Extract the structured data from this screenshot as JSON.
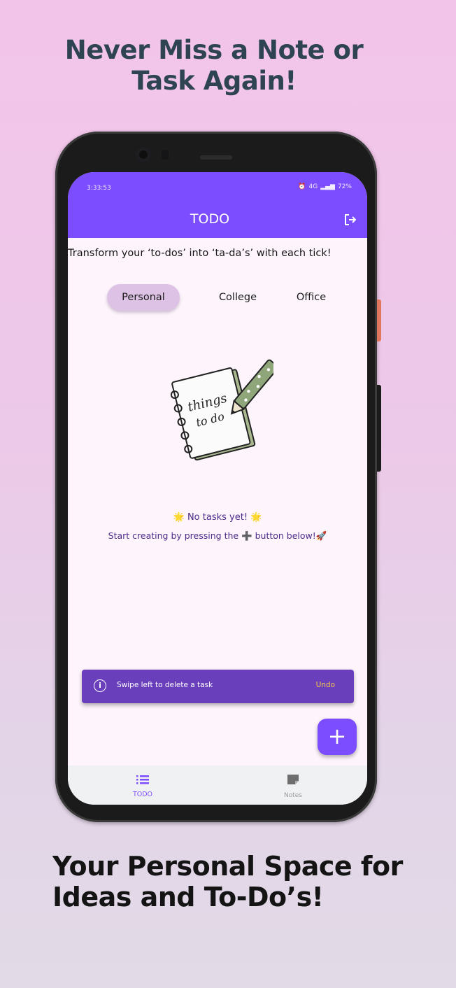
{
  "promo": {
    "headline_line1": "Never Miss a Note or",
    "headline_line2": "Task Again!",
    "footer_line1": "Your Personal Space for",
    "footer_line2": "Ideas and To-Do’s!"
  },
  "status_bar": {
    "time": "3:33:53",
    "battery": "72%",
    "network": "4G"
  },
  "app_bar": {
    "title": "TODO",
    "logout_icon": "logout-icon"
  },
  "tagline": "Transform your ‘to-dos’ into ‘ta-da’s’ with each tick!",
  "tabs": [
    {
      "label": "Personal",
      "selected": true
    },
    {
      "label": "College",
      "selected": false
    },
    {
      "label": "Office",
      "selected": false
    }
  ],
  "illustration": {
    "text_line1": "things",
    "text_line2": "to do"
  },
  "empty_state": {
    "line1": "🌟 No tasks yet! 🌟",
    "line2": "Start creating by pressing the ➕ button below!🚀"
  },
  "snackbar": {
    "icon": "info-icon",
    "message": "Swipe left to delete a task",
    "action": "Undo"
  },
  "fab": {
    "icon": "plus-icon",
    "label": "+"
  },
  "bottom_nav": {
    "items": [
      {
        "label": "TODO",
        "icon": "list-icon",
        "active": true
      },
      {
        "label": "Notes",
        "icon": "note-icon",
        "active": false
      }
    ]
  },
  "colors": {
    "primary": "#7c4dfe",
    "snackbar": "#6a3fbc",
    "undo": "#f3c64a",
    "tab_selected": "#ddc2e6"
  }
}
